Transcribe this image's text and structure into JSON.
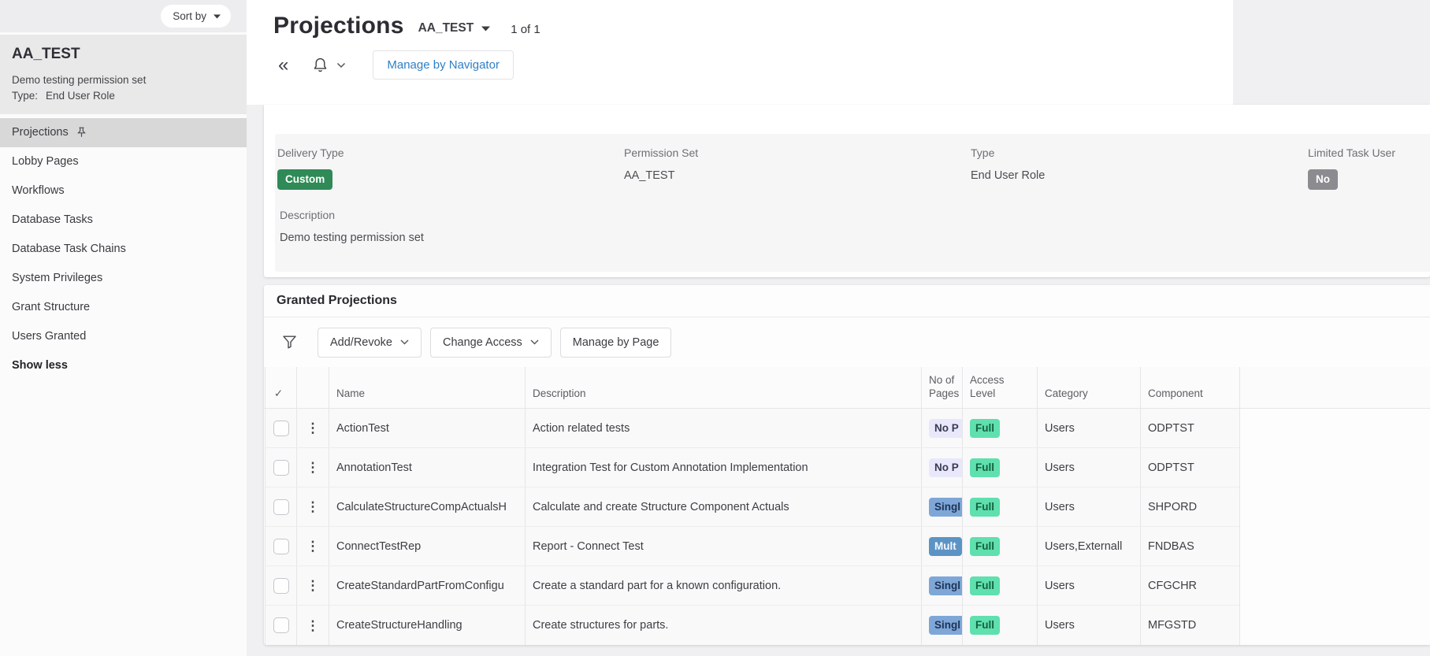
{
  "colors": {
    "accent_blue": "#2e7fc6",
    "badge_green": "#2f8a57",
    "badge_gray": "#8c8c90",
    "badge_lavender": "#e9e8fb",
    "badge_blue": "#7ea7d8",
    "badge_steel_blue": "#5c93c5",
    "badge_mint": "#5fe0ae",
    "selected_nav_bg": "#d8d8d9"
  },
  "sidebar": {
    "sort_by_label": "Sort by",
    "entity": {
      "name": "AA_TEST",
      "description": "Demo testing permission set",
      "type_label": "Type:",
      "type_value": "End User Role"
    },
    "nav_items": [
      {
        "label": "Projections"
      },
      {
        "label": "Lobby Pages"
      },
      {
        "label": "Workflows"
      },
      {
        "label": "Database Tasks"
      },
      {
        "label": "Database Task Chains"
      },
      {
        "label": "System Privileges"
      },
      {
        "label": "Grant Structure"
      },
      {
        "label": "Users Granted"
      }
    ],
    "show_less_label": "Show less"
  },
  "header": {
    "title": "Projections",
    "entity_selector": "AA_TEST",
    "record_count": "1 of 1",
    "manage_by_navigator_label": "Manage by Navigator"
  },
  "details": {
    "fields": [
      {
        "label": "Delivery Type",
        "value": "Custom"
      },
      {
        "label": "Permission Set",
        "value": "AA_TEST"
      },
      {
        "label": "Type",
        "value": "End User Role"
      },
      {
        "label": "Limited Task User",
        "value": "No"
      }
    ],
    "description_label": "Description",
    "description_value": "Demo testing permission set"
  },
  "granted": {
    "title": "Granted Projections",
    "toolbar": {
      "add_revoke": "Add/Revoke",
      "change_access": "Change Access",
      "manage_by_page": "Manage by Page"
    },
    "table": {
      "columns": {
        "select": "✓",
        "name": "Name",
        "description": "Description",
        "no_of_pages": "No of Pages",
        "access_level": "Access Level",
        "category": "Category",
        "component": "Component"
      },
      "rows": [
        {
          "name": "ActionTest",
          "description": "Action related tests",
          "no_of_pages": "No P",
          "pages_variant": "none",
          "access_level": "Full",
          "access_variant": "full",
          "category": "Users",
          "component": "ODPTST"
        },
        {
          "name": "AnnotationTest",
          "description": "Integration Test for Custom Annotation Implementation",
          "no_of_pages": "No P",
          "pages_variant": "none",
          "access_level": "Full",
          "access_variant": "full",
          "category": "Users",
          "component": "ODPTST"
        },
        {
          "name": "CalculateStructureCompActualsH",
          "description": "Calculate and create Structure Component Actuals",
          "no_of_pages": "Singl",
          "pages_variant": "single",
          "access_level": "Full",
          "access_variant": "full",
          "category": "Users",
          "component": "SHPORD"
        },
        {
          "name": "ConnectTestRep",
          "description": "Report - Connect Test",
          "no_of_pages": "Mult",
          "pages_variant": "multiple",
          "access_level": "Full",
          "access_variant": "full",
          "category": "Users,Externall",
          "component": "FNDBAS"
        },
        {
          "name": "CreateStandardPartFromConfigu",
          "description": "Create a standard part for a known configuration.",
          "no_of_pages": "Singl",
          "pages_variant": "single",
          "access_level": "Full",
          "access_variant": "full",
          "category": "Users",
          "component": "CFGCHR"
        },
        {
          "name": "CreateStructureHandling",
          "description": "Create structures for parts.",
          "no_of_pages": "Singl",
          "pages_variant": "single",
          "access_level": "Full",
          "access_variant": "full",
          "category": "Users",
          "component": "MFGSTD"
        }
      ]
    }
  }
}
